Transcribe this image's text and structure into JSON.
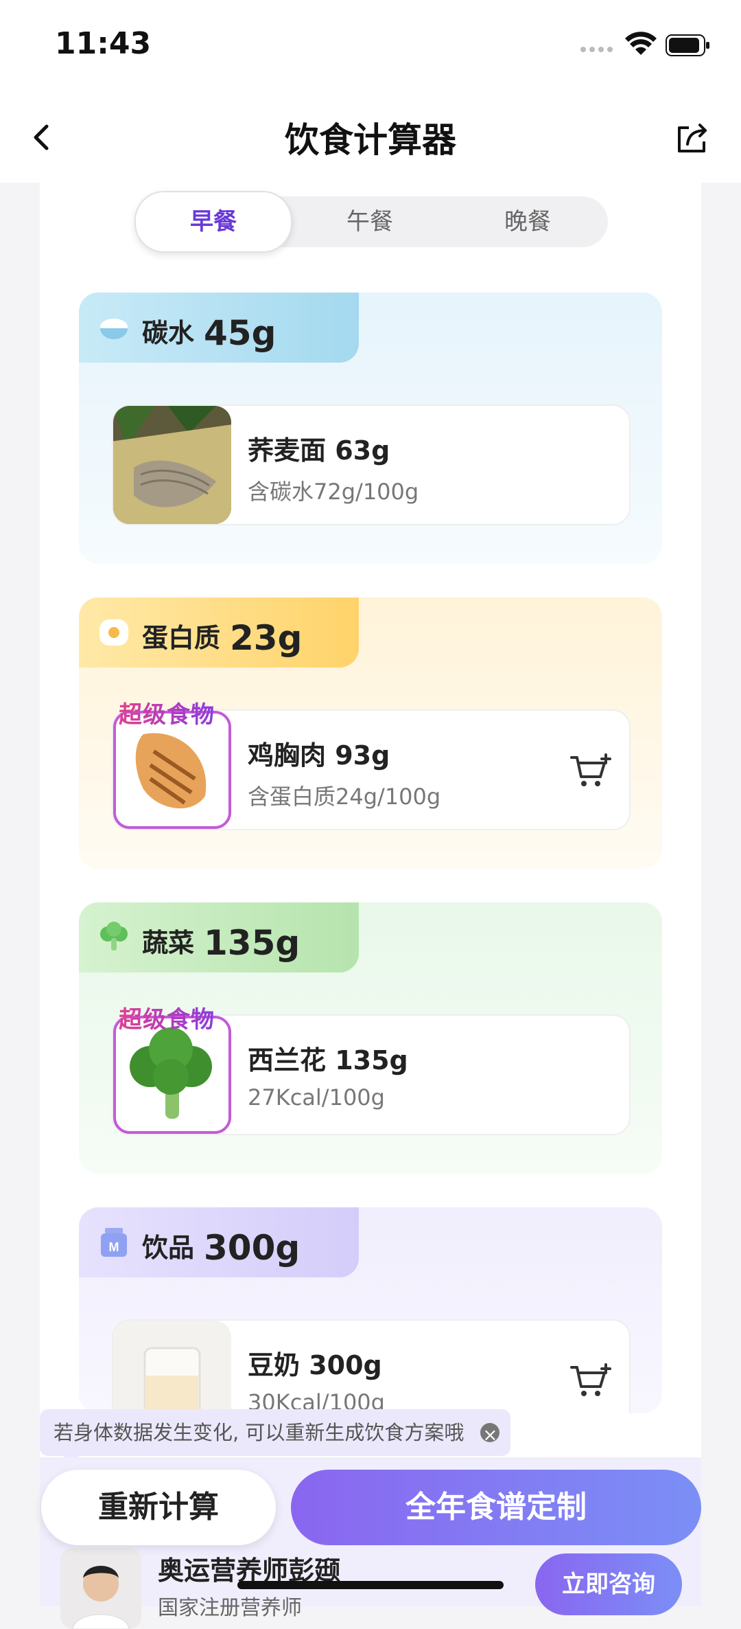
{
  "status_bar": {
    "time": "11:43"
  },
  "nav": {
    "title": "饮食计算器"
  },
  "tabs": [
    {
      "label": "早餐",
      "active": true
    },
    {
      "label": "午餐",
      "active": false
    },
    {
      "label": "晚餐",
      "active": false
    }
  ],
  "sections": [
    {
      "name": "碳水",
      "amount": "45g",
      "icon": "rice-bowl-icon",
      "food": {
        "name": "荞麦面 63g",
        "sub": "含碳水72g/100g",
        "super": "",
        "cart": false
      }
    },
    {
      "name": "蛋白质",
      "amount": "23g",
      "icon": "egg-icon",
      "food": {
        "name": "鸡胸肉 93g",
        "sub": "含蛋白质24g/100g",
        "super": "超级食物",
        "cart": true
      }
    },
    {
      "name": "蔬菜",
      "amount": "135g",
      "icon": "vegetable-icon",
      "food": {
        "name": "西兰花 135g",
        "sub": "27Kcal/100g",
        "super": "超级食物",
        "cart": false
      }
    },
    {
      "name": "饮品",
      "amount": "300g",
      "icon": "milk-carton-icon",
      "food": {
        "name": "豆奶 300g",
        "sub": "30Kcal/100g",
        "super": "",
        "cart": true
      }
    }
  ],
  "tip": {
    "text": "若身体数据发生变化, 可以重新生成饮食方案哦"
  },
  "actions": {
    "recalc": "重新计算",
    "plan": "全年食谱定制"
  },
  "consultant": {
    "name": "奥运营养师彭颋",
    "subtitle": "国家注册营养师",
    "button": "立即咨询"
  },
  "colors": {
    "accent": "#6a38d8",
    "carb_bg": "#e9f5fb",
    "carb_header": "#a5dcf0",
    "protein_bg": "#fff7e6",
    "protein_header": "#ffd77a",
    "veg_bg": "#eefaee",
    "veg_header": "#bfe8b6",
    "drink_bg": "#f5f3fd",
    "drink_header": "#d9d3fb"
  }
}
